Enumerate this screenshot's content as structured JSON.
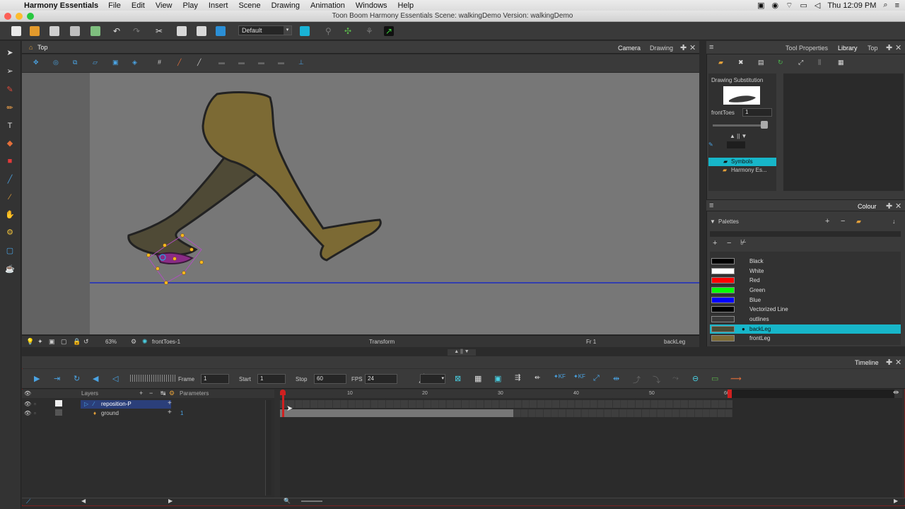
{
  "menubar": {
    "app_name": "Harmony Essentials",
    "items": [
      "File",
      "Edit",
      "View",
      "Play",
      "Insert",
      "Scene",
      "Drawing",
      "Animation",
      "Windows",
      "Help"
    ],
    "clock": "Thu 12:09 PM"
  },
  "window": {
    "title": "Toon Boom Harmony Essentials Scene: walkingDemo Version: walkingDemo"
  },
  "toolbar": {
    "workspace": "Default"
  },
  "view": {
    "tab_title": "Top",
    "tabs": [
      "Camera",
      "Drawing"
    ],
    "zoom": "63%",
    "current_drawing": "frontToes-1",
    "tool_name": "Transform",
    "frame_label": "Fr 1",
    "current_layer": "backLeg"
  },
  "right_panel": {
    "tabs": [
      "Tool Properties",
      "Library",
      "Top"
    ],
    "drawing_substitution_label": "Drawing Substitution",
    "drawing_name": "frontToes",
    "drawing_value": "1",
    "library_items": [
      "Symbols",
      "Harmony Es..."
    ],
    "colour_tab": "Colour",
    "palettes_label": "Palettes",
    "palette": [
      {
        "name": "Black",
        "color": "#000000"
      },
      {
        "name": "White",
        "color": "#ffffff"
      },
      {
        "name": "Red",
        "color": "#ff0000"
      },
      {
        "name": "Green",
        "color": "#00ff00"
      },
      {
        "name": "Blue",
        "color": "#0000ff"
      },
      {
        "name": "Vectorized Line",
        "color": "#000000"
      },
      {
        "name": "outlines",
        "color": "#3a3a3a"
      },
      {
        "name": "backLeg",
        "color": "#4b4a33"
      },
      {
        "name": "frontLeg",
        "color": "#7c6a34"
      }
    ],
    "selected_palette_index": 7
  },
  "timeline": {
    "tab": "Timeline",
    "frame_label": "Frame",
    "frame_value": "1",
    "start_label": "Start",
    "start_value": "1",
    "stop_label": "Stop",
    "stop_value": "60",
    "fps_label": "FPS",
    "fps_value": "24",
    "layers_header": "Layers",
    "parameters_header": "Parameters",
    "layers": [
      {
        "name": "reposition-P",
        "selected": true
      },
      {
        "name": "ground",
        "selected": false
      }
    ],
    "ground_param": "1",
    "ruler": [
      "10",
      "20",
      "30",
      "40",
      "50",
      "60",
      "70",
      "80"
    ]
  }
}
